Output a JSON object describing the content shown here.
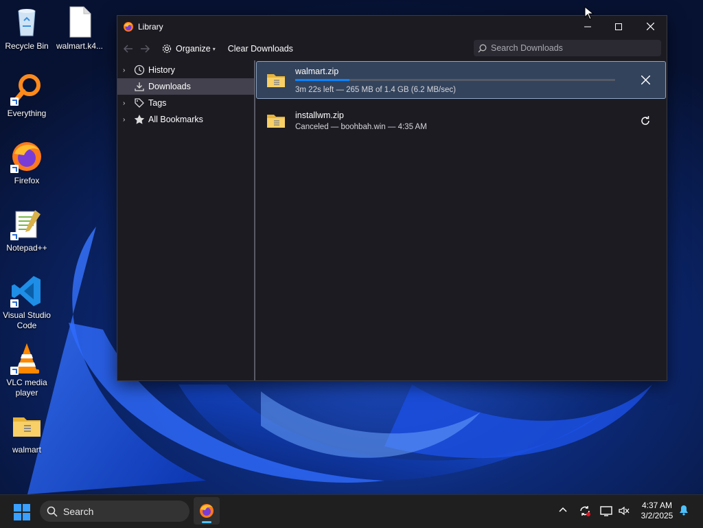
{
  "desktop": {
    "icons": [
      {
        "label": "Recycle Bin"
      },
      {
        "label": "walmart.k4..."
      },
      {
        "label": "Everything"
      },
      {
        "label": "Firefox"
      },
      {
        "label": "Notepad++"
      },
      {
        "label": "Visual Studio Code"
      },
      {
        "label": "VLC media player"
      },
      {
        "label": "walmart"
      }
    ]
  },
  "window": {
    "title": "Library",
    "toolbar": {
      "organize_label": "Organize",
      "clear_label": "Clear Downloads",
      "search_placeholder": "Search Downloads"
    },
    "sidebar": {
      "items": [
        {
          "label": "History",
          "icon": "clock-icon"
        },
        {
          "label": "Downloads",
          "icon": "download-icon",
          "selected": true
        },
        {
          "label": "Tags",
          "icon": "tag-icon"
        },
        {
          "label": "All Bookmarks",
          "icon": "star-icon"
        }
      ]
    },
    "downloads": [
      {
        "name": "walmart.zip",
        "status": "3m 22s left — 265 MB of 1.4 GB (6.2 MB/sec)",
        "progress": 0.17,
        "action": "cancel-icon"
      },
      {
        "name": "installwm.zip",
        "status": "Canceled — boohbah.win — 4:35 AM",
        "action": "retry-icon"
      }
    ]
  },
  "taskbar": {
    "search_placeholder": "Search",
    "time": "4:37 AM",
    "date": "3/2/2025"
  },
  "colors": {
    "accent": "#0a84ff",
    "window_bg": "#1c1b22",
    "selection": "#33435c",
    "taskbar_bg": "#1f1f1f"
  }
}
